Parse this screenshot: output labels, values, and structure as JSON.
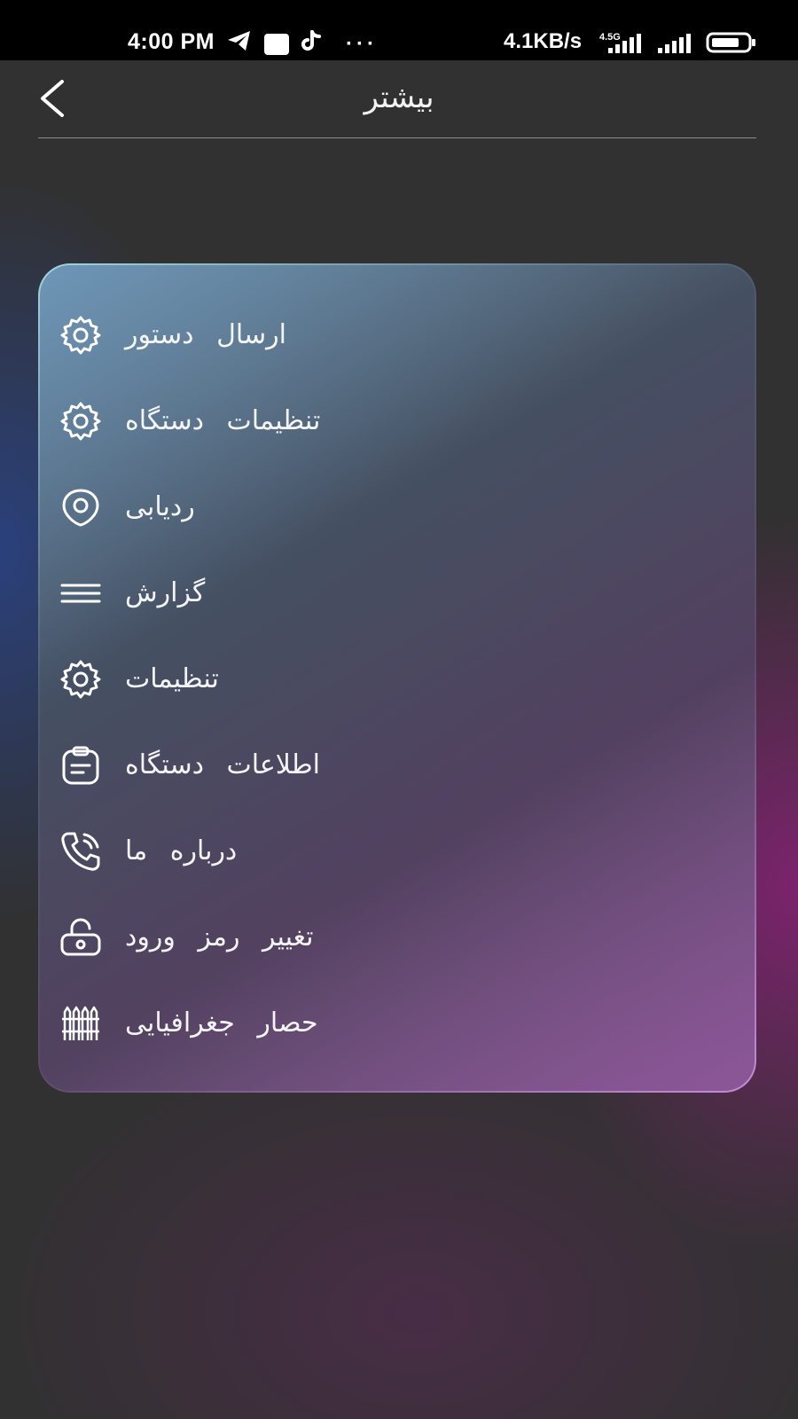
{
  "status_bar": {
    "time": "4:00 PM",
    "dots": "···",
    "net_speed": "4.1KB/s",
    "network_type": "4.5G",
    "icons": [
      "telegram-icon",
      "notification-square-icon",
      "tiktok-icon",
      "more-dots-icon",
      "signal-icon",
      "signal-icon",
      "battery-icon"
    ]
  },
  "header": {
    "title": "بیشتر",
    "back_icon": "chevron-left-icon"
  },
  "menu": {
    "items": [
      {
        "label": "ارسال دستور",
        "icon": "gear-icon"
      },
      {
        "label": "تنظیمات دستگاه",
        "icon": "gear-icon"
      },
      {
        "label": "ردیابی",
        "icon": "location-pin-icon"
      },
      {
        "label": "گزارش",
        "icon": "menu-lines-icon"
      },
      {
        "label": "تنظیمات",
        "icon": "gear-icon"
      },
      {
        "label": "اطلاعات دستگاه",
        "icon": "clipboard-icon"
      },
      {
        "label": "درباره ما",
        "icon": "phone-icon"
      },
      {
        "label": "تغییر رمز ورود",
        "icon": "lock-icon"
      },
      {
        "label": "حصار جغرافیایی",
        "icon": "fence-icon"
      }
    ]
  },
  "colors": {
    "background": "#313131",
    "status_bar": "#000000",
    "card_border_start": "#9fd6e0",
    "card_border_end": "#c58ed8",
    "text": "#f4f4f4"
  }
}
